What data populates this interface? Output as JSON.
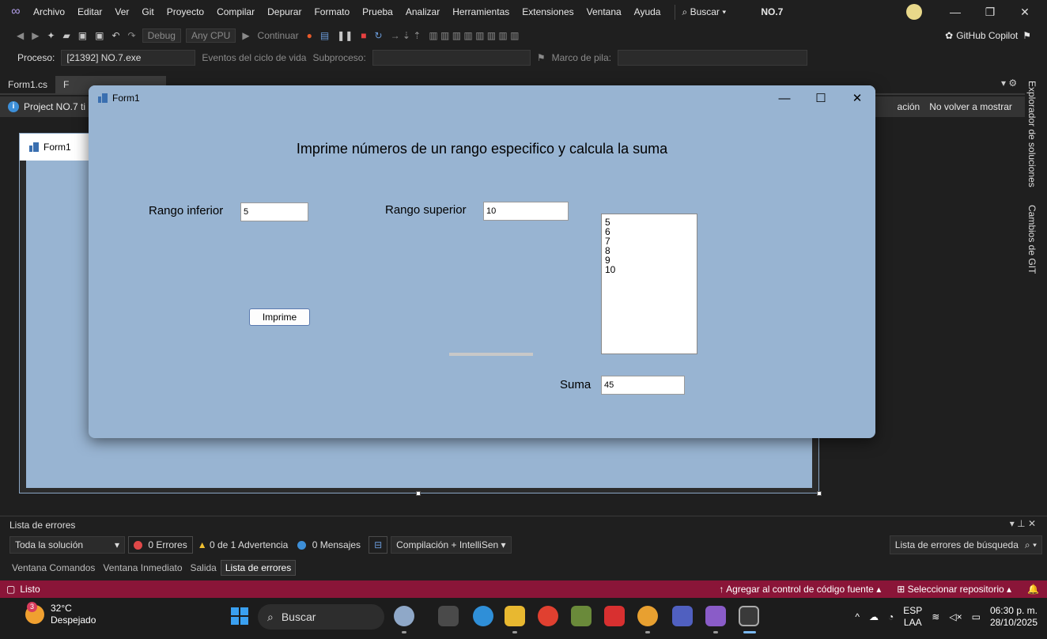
{
  "menubar": {
    "items": [
      "Archivo",
      "Editar",
      "Ver",
      "Git",
      "Proyecto",
      "Compilar",
      "Depurar",
      "Formato",
      "Prueba",
      "Analizar",
      "Herramientas",
      "Extensiones",
      "Ventana",
      "Ayuda"
    ],
    "search_label": "Buscar",
    "solution_name": "NO.7"
  },
  "toolbar": {
    "config": "Debug",
    "platform": "Any CPU",
    "continue_label": "Continuar",
    "copilot_label": "GitHub Copilot"
  },
  "procbar": {
    "process_label": "Proceso:",
    "process_value": "[21392] NO.7.exe",
    "lifecycle_label": "Eventos del ciclo de vida",
    "thread_label": "Subproceso:",
    "stack_label": "Marco de pila:"
  },
  "doc_tabs": {
    "first": "Form1.cs",
    "second": "F"
  },
  "infobar": {
    "text": "Project NO.7 ti",
    "right_text": "ación",
    "dismiss_label": "No volver a mostrar"
  },
  "designer": {
    "form_title": "Form1"
  },
  "right_tabs": [
    "Explorador de soluciones",
    "Cambios de GIT"
  ],
  "run_form": {
    "title": "Form1",
    "heading": "Imprime números de un rango especifico y calcula la suma",
    "lower_label": "Rango inferior",
    "lower_value": "5",
    "upper_label": "Rango superior",
    "upper_value": "10",
    "button_label": "Imprime",
    "list_items": [
      "5",
      "6",
      "7",
      "8",
      "9",
      "10"
    ],
    "sum_label": "Suma",
    "sum_value": "45"
  },
  "errors": {
    "title": "Lista de errores",
    "scope": "Toda la solución",
    "errors_label": "0 Errores",
    "warnings_label": "0 de 1 Advertencia",
    "messages_label": "0 Mensajes",
    "build_filter": "Compilación + IntelliSen",
    "search_label": "Lista de errores de búsqueda"
  },
  "bottom_tabs": [
    "Ventana Comandos",
    "Ventana Inmediato",
    "Salida",
    "Lista de errores"
  ],
  "status": {
    "left": "Listo",
    "source_control": "Agregar al control de código fuente",
    "repo": "Seleccionar repositorio"
  },
  "taskbar": {
    "temperature": "32°C",
    "weather": "Despejado",
    "weather_badge": "3",
    "search": "Buscar",
    "lang": "ESP",
    "lang2": "LAA",
    "time": "06:30 p. m.",
    "date": "28/10/2025"
  }
}
